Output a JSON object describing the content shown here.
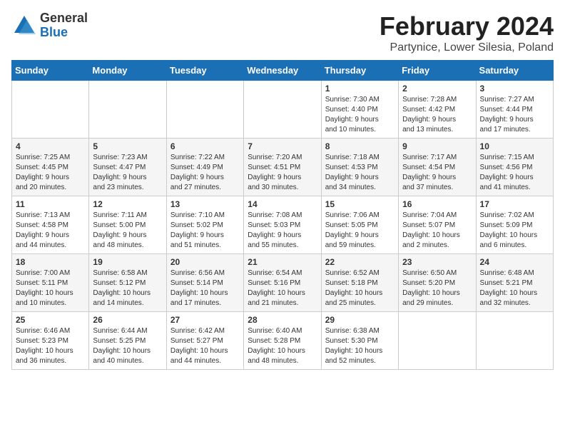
{
  "logo": {
    "general": "General",
    "blue": "Blue"
  },
  "header": {
    "title": "February 2024",
    "subtitle": "Partynice, Lower Silesia, Poland"
  },
  "weekdays": [
    "Sunday",
    "Monday",
    "Tuesday",
    "Wednesday",
    "Thursday",
    "Friday",
    "Saturday"
  ],
  "weeks": [
    [
      {
        "day": null,
        "info": ""
      },
      {
        "day": null,
        "info": ""
      },
      {
        "day": null,
        "info": ""
      },
      {
        "day": null,
        "info": ""
      },
      {
        "day": "1",
        "info": "Sunrise: 7:30 AM\nSunset: 4:40 PM\nDaylight: 9 hours\nand 10 minutes."
      },
      {
        "day": "2",
        "info": "Sunrise: 7:28 AM\nSunset: 4:42 PM\nDaylight: 9 hours\nand 13 minutes."
      },
      {
        "day": "3",
        "info": "Sunrise: 7:27 AM\nSunset: 4:44 PM\nDaylight: 9 hours\nand 17 minutes."
      }
    ],
    [
      {
        "day": "4",
        "info": "Sunrise: 7:25 AM\nSunset: 4:45 PM\nDaylight: 9 hours\nand 20 minutes."
      },
      {
        "day": "5",
        "info": "Sunrise: 7:23 AM\nSunset: 4:47 PM\nDaylight: 9 hours\nand 23 minutes."
      },
      {
        "day": "6",
        "info": "Sunrise: 7:22 AM\nSunset: 4:49 PM\nDaylight: 9 hours\nand 27 minutes."
      },
      {
        "day": "7",
        "info": "Sunrise: 7:20 AM\nSunset: 4:51 PM\nDaylight: 9 hours\nand 30 minutes."
      },
      {
        "day": "8",
        "info": "Sunrise: 7:18 AM\nSunset: 4:53 PM\nDaylight: 9 hours\nand 34 minutes."
      },
      {
        "day": "9",
        "info": "Sunrise: 7:17 AM\nSunset: 4:54 PM\nDaylight: 9 hours\nand 37 minutes."
      },
      {
        "day": "10",
        "info": "Sunrise: 7:15 AM\nSunset: 4:56 PM\nDaylight: 9 hours\nand 41 minutes."
      }
    ],
    [
      {
        "day": "11",
        "info": "Sunrise: 7:13 AM\nSunset: 4:58 PM\nDaylight: 9 hours\nand 44 minutes."
      },
      {
        "day": "12",
        "info": "Sunrise: 7:11 AM\nSunset: 5:00 PM\nDaylight: 9 hours\nand 48 minutes."
      },
      {
        "day": "13",
        "info": "Sunrise: 7:10 AM\nSunset: 5:02 PM\nDaylight: 9 hours\nand 51 minutes."
      },
      {
        "day": "14",
        "info": "Sunrise: 7:08 AM\nSunset: 5:03 PM\nDaylight: 9 hours\nand 55 minutes."
      },
      {
        "day": "15",
        "info": "Sunrise: 7:06 AM\nSunset: 5:05 PM\nDaylight: 9 hours\nand 59 minutes."
      },
      {
        "day": "16",
        "info": "Sunrise: 7:04 AM\nSunset: 5:07 PM\nDaylight: 10 hours\nand 2 minutes."
      },
      {
        "day": "17",
        "info": "Sunrise: 7:02 AM\nSunset: 5:09 PM\nDaylight: 10 hours\nand 6 minutes."
      }
    ],
    [
      {
        "day": "18",
        "info": "Sunrise: 7:00 AM\nSunset: 5:11 PM\nDaylight: 10 hours\nand 10 minutes."
      },
      {
        "day": "19",
        "info": "Sunrise: 6:58 AM\nSunset: 5:12 PM\nDaylight: 10 hours\nand 14 minutes."
      },
      {
        "day": "20",
        "info": "Sunrise: 6:56 AM\nSunset: 5:14 PM\nDaylight: 10 hours\nand 17 minutes."
      },
      {
        "day": "21",
        "info": "Sunrise: 6:54 AM\nSunset: 5:16 PM\nDaylight: 10 hours\nand 21 minutes."
      },
      {
        "day": "22",
        "info": "Sunrise: 6:52 AM\nSunset: 5:18 PM\nDaylight: 10 hours\nand 25 minutes."
      },
      {
        "day": "23",
        "info": "Sunrise: 6:50 AM\nSunset: 5:20 PM\nDaylight: 10 hours\nand 29 minutes."
      },
      {
        "day": "24",
        "info": "Sunrise: 6:48 AM\nSunset: 5:21 PM\nDaylight: 10 hours\nand 32 minutes."
      }
    ],
    [
      {
        "day": "25",
        "info": "Sunrise: 6:46 AM\nSunset: 5:23 PM\nDaylight: 10 hours\nand 36 minutes."
      },
      {
        "day": "26",
        "info": "Sunrise: 6:44 AM\nSunset: 5:25 PM\nDaylight: 10 hours\nand 40 minutes."
      },
      {
        "day": "27",
        "info": "Sunrise: 6:42 AM\nSunset: 5:27 PM\nDaylight: 10 hours\nand 44 minutes."
      },
      {
        "day": "28",
        "info": "Sunrise: 6:40 AM\nSunset: 5:28 PM\nDaylight: 10 hours\nand 48 minutes."
      },
      {
        "day": "29",
        "info": "Sunrise: 6:38 AM\nSunset: 5:30 PM\nDaylight: 10 hours\nand 52 minutes."
      },
      {
        "day": null,
        "info": ""
      },
      {
        "day": null,
        "info": ""
      }
    ]
  ]
}
